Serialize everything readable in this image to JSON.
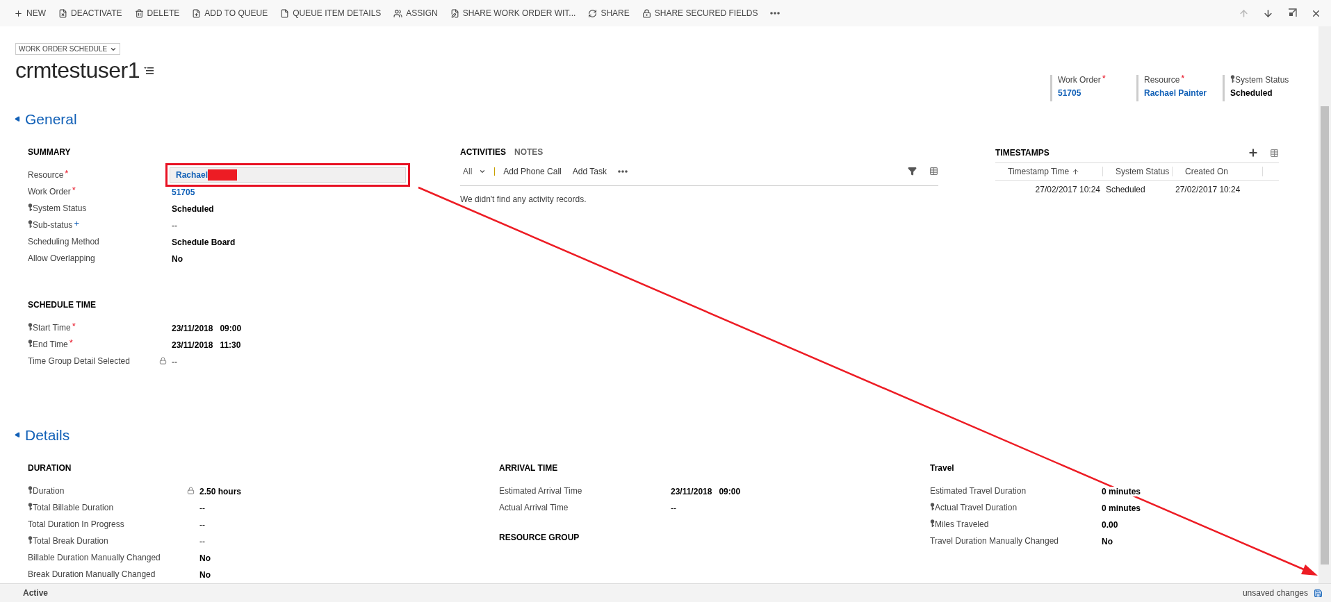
{
  "toolbar": {
    "items": [
      {
        "label": "NEW"
      },
      {
        "label": "DEACTIVATE"
      },
      {
        "label": "DELETE"
      },
      {
        "label": "ADD TO QUEUE"
      },
      {
        "label": "QUEUE ITEM DETAILS"
      },
      {
        "label": "ASSIGN"
      },
      {
        "label": "SHARE WORK ORDER WIT..."
      },
      {
        "label": "SHARE"
      },
      {
        "label": "SHARE SECURED FIELDS"
      }
    ],
    "nav": [
      {
        "disabled": true
      },
      {
        "disabled": false
      },
      {
        "disabled": false
      },
      {
        "disabled": false
      }
    ]
  },
  "header": {
    "form_selector": "WORK ORDER SCHEDULE",
    "title": "crmtestuser1",
    "fields": [
      {
        "label": "Work Order",
        "marker": {
          "kind": "required",
          "text": "*"
        },
        "secured": false,
        "value": "51705",
        "kind": "link"
      },
      {
        "label": "Resource",
        "marker": {
          "kind": "required",
          "text": "*"
        },
        "secured": false,
        "value": "Rachael Painter",
        "kind": "link"
      },
      {
        "label": "System Status",
        "secured": true,
        "value": "Scheduled",
        "kind": "bold"
      }
    ]
  },
  "general": {
    "title": "General",
    "expanded": true,
    "summary": {
      "heading": "SUMMARY",
      "fields": [
        {
          "label": "Resource",
          "marker": {
            "kind": "required",
            "text": "*"
          },
          "secured": false,
          "locked": false,
          "value": "Rachael",
          "kind": "lookup",
          "redacted": true,
          "highlighted": true
        },
        {
          "label": "Work Order",
          "marker": {
            "kind": "required",
            "text": "*"
          },
          "secured": false,
          "locked": false,
          "value": "51705",
          "kind": "link"
        },
        {
          "label": "System Status",
          "secured": true,
          "locked": false,
          "value": "Scheduled",
          "kind": "bold"
        },
        {
          "label": "Sub-status",
          "marker": {
            "kind": "recommended",
            "text": "+"
          },
          "secured": true,
          "locked": false,
          "value": "--",
          "kind": "plain"
        },
        {
          "label": "Scheduling Method",
          "secured": false,
          "locked": false,
          "value": "Schedule Board",
          "kind": "bold"
        },
        {
          "label": "Allow Overlapping",
          "secured": false,
          "locked": false,
          "value": "No",
          "kind": "bold"
        }
      ]
    },
    "schedule_time": {
      "heading": "SCHEDULE TIME",
      "fields": [
        {
          "label": "Start Time",
          "marker": {
            "kind": "required",
            "text": "*"
          },
          "secured": true,
          "locked": false,
          "value": "23/11/2018   09:00",
          "kind": "bold"
        },
        {
          "label": "End Time",
          "marker": {
            "kind": "required",
            "text": "*"
          },
          "secured": true,
          "locked": false,
          "value": "23/11/2018   11:30",
          "kind": "bold"
        },
        {
          "label": "Time Group Detail Selected",
          "secured": false,
          "locked": true,
          "value": "--",
          "kind": "plain"
        }
      ]
    },
    "activities": {
      "tabs": [
        {
          "label": "ACTIVITIES",
          "selected": true
        },
        {
          "label": "NOTES",
          "selected": false
        }
      ],
      "filter": "All",
      "actions": [
        "Add Phone Call",
        "Add Task"
      ],
      "empty_message": "We didn't find any activity records."
    },
    "timestamps": {
      "heading": "TIMESTAMPS",
      "columns": [
        {
          "label": "Timestamp Time",
          "sorted": true
        },
        {
          "label": "System Status",
          "sorted": false
        },
        {
          "label": "Created On",
          "sorted": false
        }
      ],
      "rows": [
        [
          "27/02/2017 10:24",
          "Scheduled",
          "27/02/2017 10:24"
        ]
      ]
    }
  },
  "details": {
    "title": "Details",
    "expanded": true,
    "columns": [
      {
        "heading": "DURATION",
        "fields": [
          {
            "label": "Duration",
            "secured": true,
            "locked": true,
            "value": "2.50 hours",
            "kind": "bold"
          },
          {
            "label": "Total Billable Duration",
            "secured": true,
            "locked": false,
            "value": "--",
            "kind": "plain"
          },
          {
            "label": "Total Duration In Progress",
            "secured": false,
            "locked": false,
            "value": "--",
            "kind": "plain"
          },
          {
            "label": "Total Break Duration",
            "secured": true,
            "locked": false,
            "value": "--",
            "kind": "plain"
          },
          {
            "label": "Billable Duration Manually Changed",
            "secured": false,
            "locked": false,
            "value": "No",
            "kind": "bold"
          },
          {
            "label": "Break Duration Manually Changed",
            "secured": false,
            "locked": false,
            "value": "No",
            "kind": "bold"
          }
        ]
      },
      {
        "heading": "ARRIVAL TIME",
        "fields": [
          {
            "label": "Estimated Arrival Time",
            "secured": false,
            "locked": false,
            "value": "23/11/2018   09:00",
            "kind": "bold"
          },
          {
            "label": "Actual Arrival Time",
            "secured": false,
            "locked": false,
            "value": "--",
            "kind": "plain"
          }
        ],
        "subheading": "RESOURCE GROUP"
      },
      {
        "heading": "Travel",
        "fields": [
          {
            "label": "Estimated Travel Duration",
            "secured": false,
            "locked": false,
            "value": "0 minutes",
            "kind": "bold"
          },
          {
            "label": "Actual Travel Duration",
            "secured": true,
            "locked": false,
            "value": "0 minutes",
            "kind": "bold"
          },
          {
            "label": "Miles Traveled",
            "secured": true,
            "locked": false,
            "value": "0.00",
            "kind": "bold"
          },
          {
            "label": "Travel Duration Manually Changed",
            "secured": false,
            "locked": false,
            "value": "No",
            "kind": "bold"
          }
        ]
      }
    ]
  },
  "status_bar": {
    "status": "Active",
    "message": "unsaved changes"
  }
}
